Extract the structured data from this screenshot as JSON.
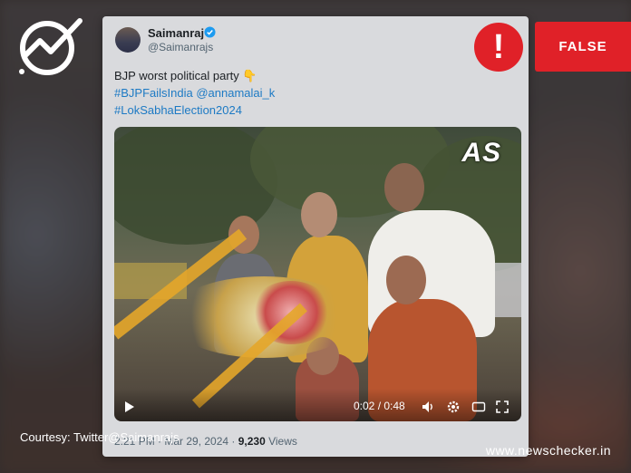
{
  "tweet": {
    "display_name": "Saimanraj",
    "handle": "@Saimanrajs",
    "text_line1": "BJP worst political party",
    "emoji": "👇",
    "hashtag1": "#BJPFailsIndia",
    "mention": "@annamalai_k",
    "hashtag2": "#LokSabhaElection2024",
    "timestamp": "2:21 PM · Mar 29, 2024 · ",
    "views_count": "9,230",
    "views_label": " Views"
  },
  "video": {
    "watermark": "AS",
    "time": "0:02 / 0:48"
  },
  "badge": {
    "alert_symbol": "!",
    "label": "FALSE"
  },
  "footer": {
    "courtesy": "Courtesy: Twitter@Saimanrajs",
    "site": "www.newschecker.in"
  },
  "colors": {
    "alert_red": "#e02128",
    "link_blue": "#1d7ac4",
    "card_bg": "#d9dadd"
  },
  "icons": [
    "newschecker-logo-icon",
    "verified-badge-icon",
    "play-icon",
    "volume-icon",
    "settings-icon",
    "fullscreen-icon",
    "alert-icon"
  ]
}
